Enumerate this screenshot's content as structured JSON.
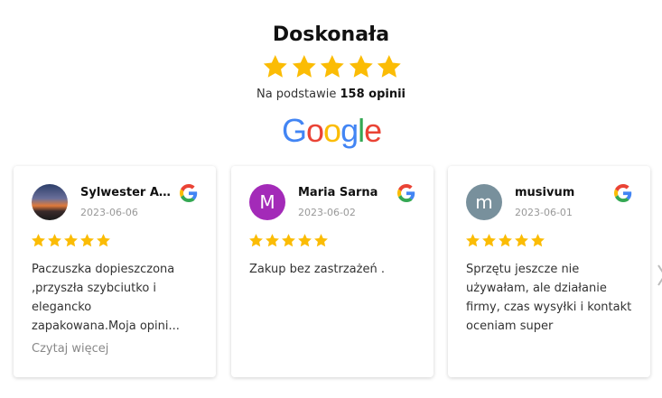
{
  "header": {
    "rating_label": "Doskonała",
    "based_prefix": "Na podstawie",
    "review_count_text": "158 opinii",
    "google_text": "Google",
    "stars": 5
  },
  "colors": {
    "star": "#fbbc05",
    "google_blue": "#4285f4",
    "google_red": "#ea4335",
    "google_yellow": "#fbbc05",
    "google_green": "#34a853"
  },
  "reviews": [
    {
      "name": "Sylwester Al...",
      "date": "2023-06-06",
      "avatar_letter": "",
      "avatar_color": "#3a4a6a",
      "rating": 5,
      "text": "Paczuszka dopieszczona ,przyszła szybciutko i elegancko zapakowana.Moja opini...",
      "read_more": "Czytaj więcej"
    },
    {
      "name": "Maria Sarna",
      "date": "2023-06-02",
      "avatar_letter": "M",
      "avatar_color": "#a32ab8",
      "rating": 5,
      "text": "Zakup bez zastrzażeń .",
      "read_more": ""
    },
    {
      "name": "musivum",
      "date": "2023-06-01",
      "avatar_letter": "m",
      "avatar_color": "#78909c",
      "rating": 5,
      "text": "Sprzętu jeszcze nie używałam, ale działanie firmy, czas wysyłki i kontakt oceniam super",
      "read_more": ""
    }
  ],
  "icons": {
    "next": "chevron-right-icon",
    "source": "google-g-icon",
    "rating": "star-icon"
  }
}
